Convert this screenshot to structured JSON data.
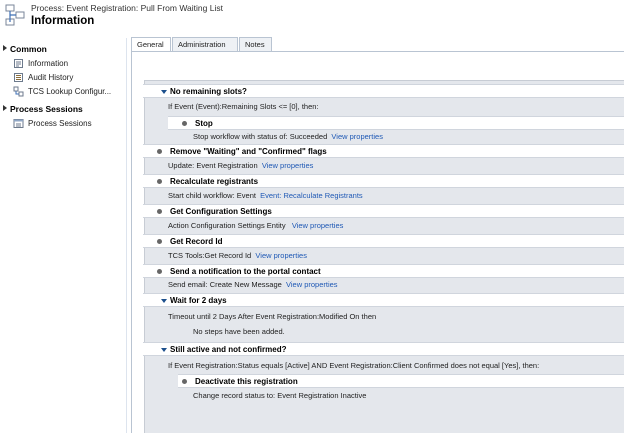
{
  "header": {
    "process_label": "Process: Event Registration: Pull From Waiting List",
    "title": "Information"
  },
  "sidebar": {
    "sections": [
      {
        "label": "Common",
        "items": [
          {
            "label": "Information",
            "icon": "information-icon"
          },
          {
            "label": "Audit History",
            "icon": "audit-history-icon"
          },
          {
            "label": "TCS Lookup Configur...",
            "icon": "lookup-config-icon"
          }
        ]
      },
      {
        "label": "Process Sessions",
        "items": [
          {
            "label": "Process Sessions",
            "icon": "process-sessions-icon"
          }
        ]
      }
    ]
  },
  "tabs": [
    "General",
    "Administration",
    "Notes"
  ],
  "workflow": {
    "s1_title": "No remaining slots?",
    "s1_cond": "If Event (Event):Remaining Slots <= [0], then:",
    "s1a_title": "Stop",
    "s1a_text": "Stop workflow with status of:  Succeeded",
    "s1a_link": "View properties",
    "s2_title": "Remove \"Waiting\" and \"Confirmed\" flags",
    "s2_text": "Update:  Event Registration",
    "s2_link": "View properties",
    "s3_title": "Recalculate registrants",
    "s3_text": "Start child workflow:  Event",
    "s3_link": "Event: Recalculate Registrants",
    "s4_title": "Get Configuration Settings",
    "s4_text": "Action  Configuration Settings  Entity",
    "s4_link": "View properties",
    "s5_title": "Get Record Id",
    "s5_text": "TCS Tools:Get Record Id",
    "s5_link": "View properties",
    "s6_title": "Send a notification to the portal contact",
    "s6_text": "Send email:  Create New Message",
    "s6_link": "View properties",
    "s7_title": "Wait for 2 days",
    "s7_cond": "Timeout until 2 Days After Event Registration:Modified On then",
    "s7_none": "No steps have been added.",
    "s8_title": "Still active and not confirmed?",
    "s8_cond": "If Event Registration:Status equals [Active] AND Event Registration:Client Confirmed does not equal [Yes], then:",
    "s8a_title": "Deactivate this registration",
    "s8a_text": "Change record status to:  Event Registration  Inactive"
  },
  "colors": {
    "link": "#1f59b5",
    "accent": "#1c4f8c",
    "canvas": "#e4e7ec"
  }
}
